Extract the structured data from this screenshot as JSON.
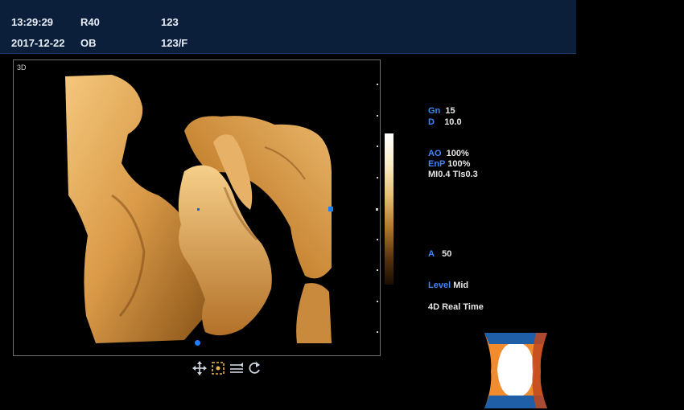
{
  "header": {
    "time": "13:29:29",
    "date": "2017-12-22",
    "probe": "R40",
    "exam": "OB",
    "patient_id": "123",
    "patient_name": "123/F",
    "bg_color": "#0b1f3a"
  },
  "viewport": {
    "mode_label": "3D"
  },
  "toolbar": {
    "icons": [
      "move-icon",
      "select-box-icon",
      "tilt-icon",
      "rotate-icon"
    ],
    "active_icon": "select-box-icon"
  },
  "params": {
    "gn_label": "Gn",
    "gn_value": "15",
    "d_label": "D",
    "d_value": "10.0",
    "ao_label": "AO",
    "ao_value": "100%",
    "enp_label": "EnP",
    "enp_value": "100%",
    "mi_ti": "MI0.4 TIs0.3",
    "a_label": "A",
    "a_value": "50",
    "level_label": "Level",
    "level_value": "Mid",
    "mode_text": "4D Real Time"
  },
  "colors": {
    "label_blue": "#3f86ff",
    "marker_blue": "#1e7dff",
    "orientation_orange": "#f28a2e",
    "orientation_blue": "#1f5fa8"
  }
}
